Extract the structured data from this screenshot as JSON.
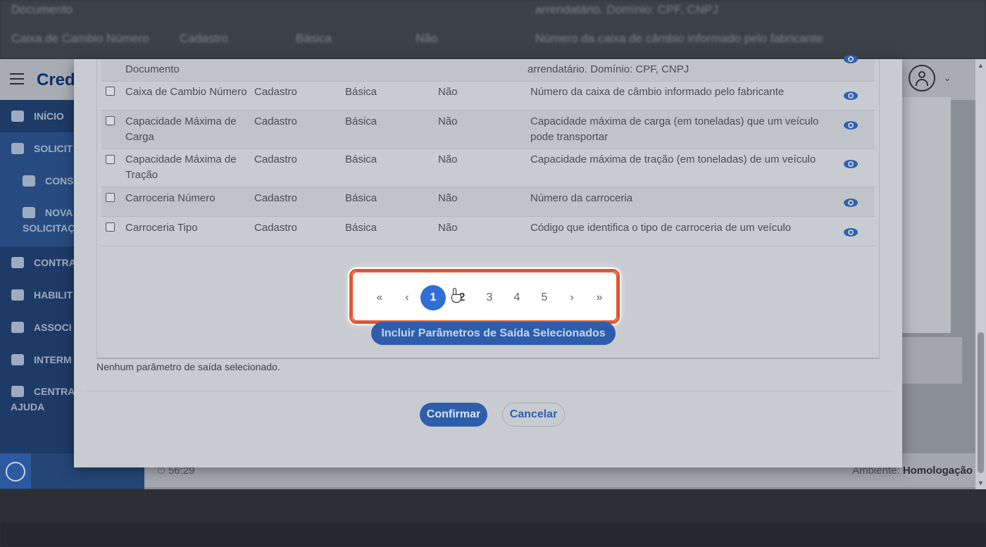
{
  "background_strip": {
    "row1_label": "Documento",
    "row1_desc": "arrendatário. Domínio: CPF, CNPJ",
    "row2_name": "Caixa de Cambio Número",
    "row2_group": "Cadastro",
    "row2_type": "Básica",
    "row2_required": "Não",
    "row2_desc": "Número da caixa de câmbio informado pelo fabricante"
  },
  "header": {
    "brand": "Cred",
    "user_icon": "user-circle-icon",
    "chevron_icon": "chevron-down-icon"
  },
  "sidebar": {
    "items": [
      {
        "label": "INÍCIO",
        "icon": "home-icon"
      },
      {
        "label": "SOLICIT",
        "icon": "edit-icon"
      },
      {
        "label": "CONS",
        "icon": "search-icon"
      },
      {
        "label": "NOVA",
        "label2": "SOLICITAÇ",
        "icon": "file-icon"
      },
      {
        "label": "CONTRA",
        "icon": "handshake-icon"
      },
      {
        "label": "HABILIT",
        "icon": "id-card-icon"
      },
      {
        "label": "ASSOCI",
        "icon": "users-icon"
      },
      {
        "label": "INTERM",
        "icon": "person-icon"
      },
      {
        "label": "CENTRA",
        "label2": "AJUDA",
        "icon": "question-icon"
      }
    ],
    "cookie_icon": "cookie-icon"
  },
  "footer": {
    "time": "56:29",
    "env_label": "Ambiente:",
    "env_value": "Homologação"
  },
  "table": {
    "rows": [
      {
        "name": "Documento",
        "name2": "",
        "group": "",
        "type": "",
        "required": "",
        "desc": "arrendatário. Domínio: CPF, CNPJ",
        "desc2": "",
        "partial": true
      },
      {
        "name": "Caixa de Cambio Número",
        "name2": "",
        "group": "Cadastro",
        "type": "Básica",
        "required": "Não",
        "desc": "Número da caixa de câmbio informado pelo fabricante",
        "desc2": ""
      },
      {
        "name": "Capacidade Máxima de",
        "name2": "Carga",
        "group": "Cadastro",
        "type": "Básica",
        "required": "Não",
        "desc": "Capacidade máxima de carga (em toneladas) que um veículo",
        "desc2": "pode transportar"
      },
      {
        "name": "Capacidade Máxima de",
        "name2": "Tração",
        "group": "Cadastro",
        "type": "Básica",
        "required": "Não",
        "desc": "Capacidade máxima de tração (em toneladas) de um veículo",
        "desc2": ""
      },
      {
        "name": "Carroceria Número",
        "name2": "",
        "group": "Cadastro",
        "type": "Básica",
        "required": "Não",
        "desc": "Número da carroceria",
        "desc2": ""
      },
      {
        "name": "Carroceria Tipo",
        "name2": "",
        "group": "Cadastro",
        "type": "Básica",
        "required": "Não",
        "desc": "Código que identifica o tipo de carroceria de um veículo",
        "desc2": ""
      }
    ]
  },
  "pagination": {
    "first": "«",
    "prev": "‹",
    "pages": [
      "1",
      "2",
      "3",
      "4",
      "5"
    ],
    "active_page": "1",
    "next": "›",
    "last": "»"
  },
  "modal": {
    "include_button": "Incluir Parâmetros de Saída Selecionados",
    "none_selected": "Nenhum parâmetro de saída selecionado.",
    "confirm_button": "Confirmar",
    "cancel_button": "Cancelar"
  }
}
